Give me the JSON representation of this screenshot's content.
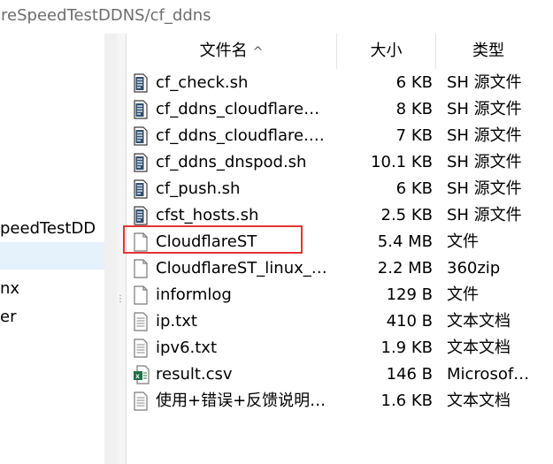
{
  "breadcrumb": {
    "path": "areSpeedTestDDNS/cf_ddns"
  },
  "nav": {
    "items": [
      {
        "label": "peedTestDD"
      },
      {
        "label": ""
      },
      {
        "label": "nx"
      },
      {
        "label": "er"
      }
    ]
  },
  "columns": {
    "name": "文件名",
    "size": "大小",
    "type": "类型",
    "sort_indicator": "^"
  },
  "files": [
    {
      "name": "cf_check.sh",
      "size": "6 KB",
      "type": "SH 源文件",
      "icon": "shell-script-icon"
    },
    {
      "name": "cf_ddns_cloudflare…",
      "size": "8 KB",
      "type": "SH 源文件",
      "icon": "shell-script-icon"
    },
    {
      "name": "cf_ddns_cloudflare.…",
      "size": "7 KB",
      "type": "SH 源文件",
      "icon": "shell-script-icon"
    },
    {
      "name": "cf_ddns_dnspod.sh",
      "size": "10.1 KB",
      "type": "SH 源文件",
      "icon": "shell-script-icon"
    },
    {
      "name": "cf_push.sh",
      "size": "6 KB",
      "type": "SH 源文件",
      "icon": "shell-script-icon"
    },
    {
      "name": "cfst_hosts.sh",
      "size": "2.5 KB",
      "type": "SH 源文件",
      "icon": "shell-script-icon"
    },
    {
      "name": "CloudflareST",
      "size": "5.4 MB",
      "type": "文件",
      "icon": "blank-file-icon"
    },
    {
      "name": "CloudflareST_linux_…",
      "size": "2.2 MB",
      "type": "360zip",
      "icon": "blank-file-icon"
    },
    {
      "name": "informlog",
      "size": "129 B",
      "type": "文件",
      "icon": "blank-file-icon"
    },
    {
      "name": "ip.txt",
      "size": "410 B",
      "type": "文本文档",
      "icon": "text-file-icon"
    },
    {
      "name": "ipv6.txt",
      "size": "1.9 KB",
      "type": "文本文档",
      "icon": "text-file-icon"
    },
    {
      "name": "result.csv",
      "size": "146 B",
      "type": "Microsof…",
      "icon": "excel-csv-icon"
    },
    {
      "name": "使用+错误+反馈说明…",
      "size": "1.6 KB",
      "type": "文本文档",
      "icon": "text-file-icon"
    }
  ],
  "colors": {
    "highlight": "#e53333",
    "selected_nav": "#e5f1fb"
  }
}
